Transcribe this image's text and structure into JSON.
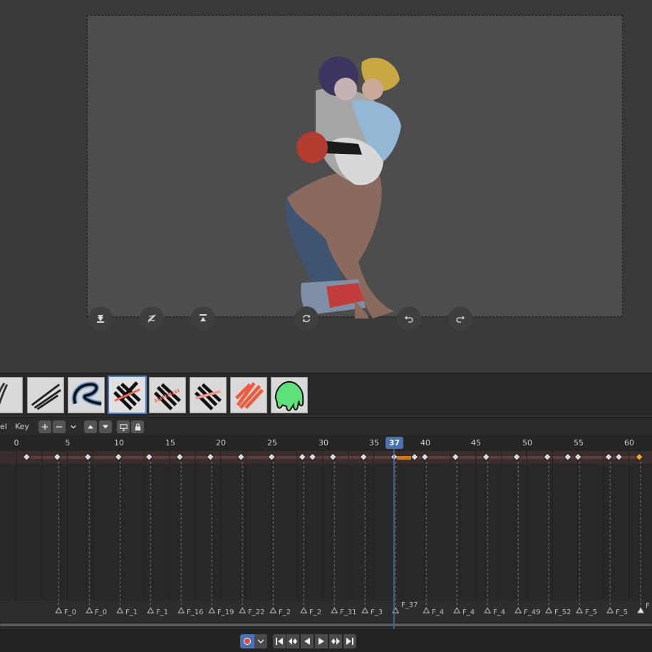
{
  "header": {
    "channel_label": "el",
    "key_menu": "Key"
  },
  "ruler": {
    "ticks": [
      "0",
      "5",
      "10",
      "15",
      "20",
      "25",
      "30",
      "35",
      "40",
      "45",
      "50",
      "55",
      "60"
    ],
    "current_frame": "37"
  },
  "markers": [
    "F_0",
    "F_0",
    "F_1",
    "F_1",
    "F_16",
    "F_19",
    "F_22",
    "F_2",
    "F_2",
    "F_31",
    "F_3",
    "F_37",
    "F_4",
    "F_4",
    "F_4",
    "F_49",
    "F_52",
    "F_5",
    "F_5",
    "F"
  ],
  "brushes": [
    "pencil-brush",
    "ink-brush",
    "marker-brush",
    "eraser-hard-brush",
    "eraser-point-brush",
    "eraser-soft-brush",
    "fill-stroke-brush",
    "tint-brush"
  ],
  "viewport_tools": [
    "move-down-icon",
    "edit-stroke-icon",
    "move-up-icon",
    "refresh-icon",
    "undo-icon",
    "redo-icon"
  ],
  "colors": {
    "accent": "#4772b3",
    "keyframe": "#d9d9d9",
    "keyframe_selected": "#f0a830",
    "track_row": "#3a2d2d"
  }
}
